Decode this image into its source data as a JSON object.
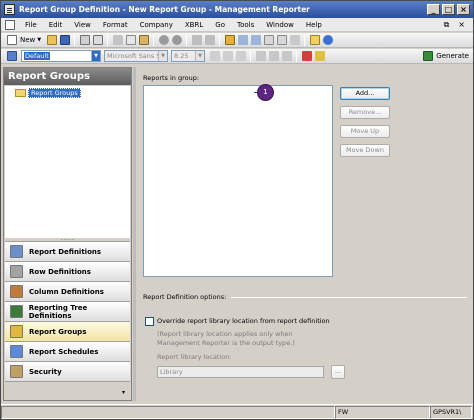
{
  "window": {
    "title": "Report Group Definition - New Report Group - Management Reporter",
    "controls": {
      "minimize": "_",
      "maximize": "□",
      "close": "×"
    }
  },
  "menu": {
    "items": [
      "File",
      "Edit",
      "View",
      "Format",
      "Company",
      "XBRL",
      "Go",
      "Tools",
      "Window",
      "Help"
    ],
    "mdi_restore": "⧉",
    "mdi_close": "×"
  },
  "toolbar": {
    "new_label": "New",
    "generate_label": "Generate"
  },
  "format_toolbar": {
    "style_value": "Default",
    "font_value": "Microsoft Sans S",
    "size_value": "8.25"
  },
  "left_pane": {
    "title": "Report Groups",
    "tree_root": "Report Groups",
    "splitter_grip": "·········",
    "nav_items": [
      {
        "label": "Report Definitions",
        "icon": "report-definitions-icon",
        "color": "#6b8fc9"
      },
      {
        "label": "Row Definitions",
        "icon": "row-definitions-icon",
        "color": "#a3a3a3"
      },
      {
        "label": "Column Definitions",
        "icon": "column-definitions-icon",
        "color": "#c07a3a"
      },
      {
        "label": "Reporting Tree Definitions",
        "icon": "reporting-tree-icon",
        "color": "#3a7a3a"
      },
      {
        "label": "Report Groups",
        "icon": "report-groups-icon",
        "color": "#e0b840",
        "active": true
      },
      {
        "label": "Report Schedules",
        "icon": "report-schedules-icon",
        "color": "#5a8ad8"
      },
      {
        "label": "Security",
        "icon": "security-icon",
        "color": "#c0a060"
      }
    ],
    "footer_chevron": "▾"
  },
  "main": {
    "reports_label": "Reports in group:",
    "buttons": {
      "add": "Add...",
      "remove": "Remove...",
      "move_up": "Move Up",
      "move_down": "Move Down"
    },
    "callout_number": "1",
    "options_label": "Report Definition options:",
    "override_label": "Override report library location from report definition",
    "override_checked": false,
    "note": "(Report library location applies only when Management Reporter is the output type.)",
    "location_label": "Report library location:",
    "location_value": "Library",
    "browse_label": "..."
  },
  "statusbar": {
    "company": "FW",
    "server": "GPSVR1\\"
  },
  "colors": {
    "title_gradient_top": "#5a7fc6",
    "selection": "#316ac5",
    "callout": "#5c2683",
    "active_nav": "#f3e3a3"
  }
}
